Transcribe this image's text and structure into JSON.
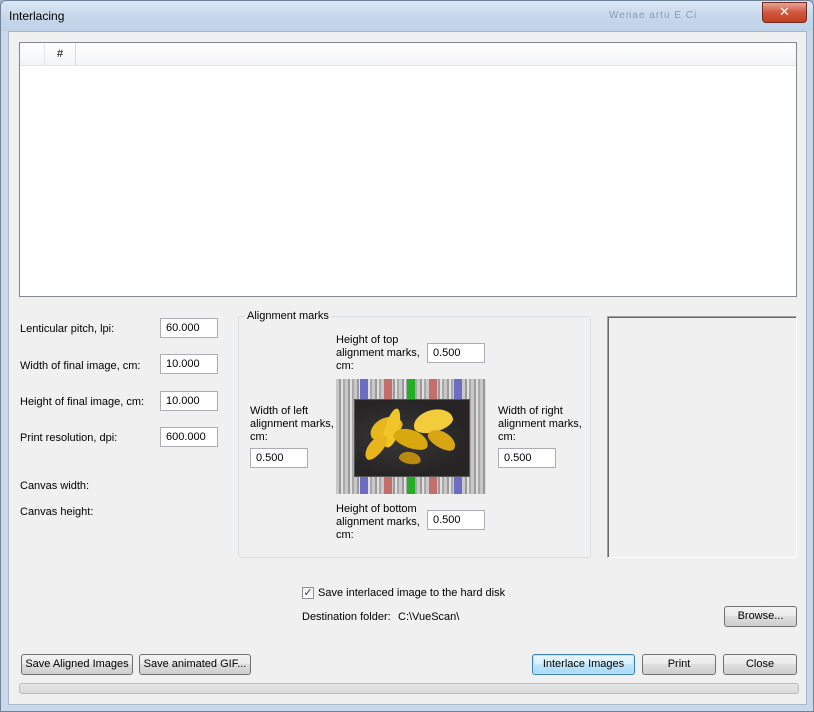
{
  "window": {
    "title": "Interlacing",
    "ghost_title": "Wenae artu E  Ci ",
    "close_glyph": "✕"
  },
  "list": {
    "columns": [
      "",
      "#"
    ],
    "rows": []
  },
  "settings": {
    "lenticular_pitch_label": "Lenticular pitch, lpi:",
    "lenticular_pitch_value": "60.000",
    "width_label": "Width of final image, cm:",
    "width_value": "10.000",
    "height_label": "Height of final image, cm:",
    "height_value": "10.000",
    "resolution_label": "Print resolution, dpi:",
    "resolution_value": "600.000",
    "canvas_width_label": "Canvas width:",
    "canvas_height_label": "Canvas height:"
  },
  "alignment": {
    "group_title": "Alignment marks",
    "top_label_1": "Height of top",
    "top_label_2": "alignment marks,",
    "top_label_3": "cm:",
    "top_value": "0.500",
    "left_label_1": "Width of left",
    "left_label_2": "alignment marks,",
    "left_label_3": "cm:",
    "left_value": "0.500",
    "right_label_1": "Width of right",
    "right_label_2": "alignment marks,",
    "right_label_3": "cm:",
    "right_value": "0.500",
    "bottom_label_1": "Height of bottom",
    "bottom_label_2": "alignment marks,",
    "bottom_label_3": "cm:",
    "bottom_value": "0.500",
    "mark_colors": [
      "#6d6dc4",
      "#c46d6d",
      "#22b022",
      "#c46d6d",
      "#6d6dc4"
    ]
  },
  "save": {
    "checkbox_checked": true,
    "checkbox_label": "Save interlaced image to the hard disk",
    "destination_label": "Destination folder:",
    "destination_value": "C:\\VueScan\\",
    "browse_label": "Browse..."
  },
  "buttons": {
    "save_aligned": "Save Aligned Images",
    "save_gif": "Save animated GIF...",
    "interlace": "Interlace Images",
    "print": "Print",
    "close": "Close"
  },
  "progress": {
    "fraction": 0
  }
}
